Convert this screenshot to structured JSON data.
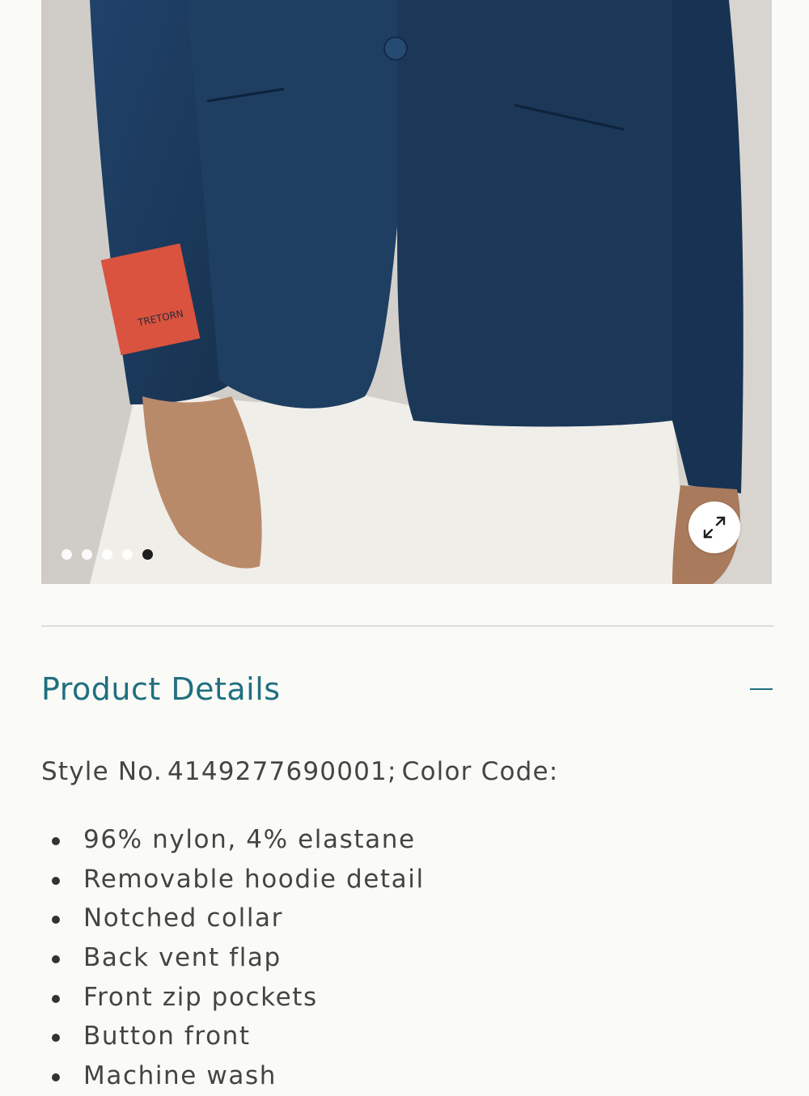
{
  "product_image": {
    "alt_icon": "product-photo",
    "patch_text": "TRETORN",
    "carousel": {
      "count": 5,
      "active_index": 4
    },
    "expand_icon": "expand-arrows-icon"
  },
  "product_details": {
    "title": "Product Details",
    "toggle_icon": "minus-icon",
    "style_label": "Style No.",
    "style_number": "4149277690001;",
    "color_label": "Color Code:",
    "features": [
      "96% nylon, 4% elastane",
      "Removable hoodie detail",
      "Notched collar",
      "Back vent flap",
      "Front zip pockets",
      "Button front",
      "Machine wash"
    ]
  },
  "colors": {
    "accent": "#1f6f80",
    "jacket": "#1d3b5c",
    "patch": "#d9533f",
    "background": "#fafaf7"
  }
}
